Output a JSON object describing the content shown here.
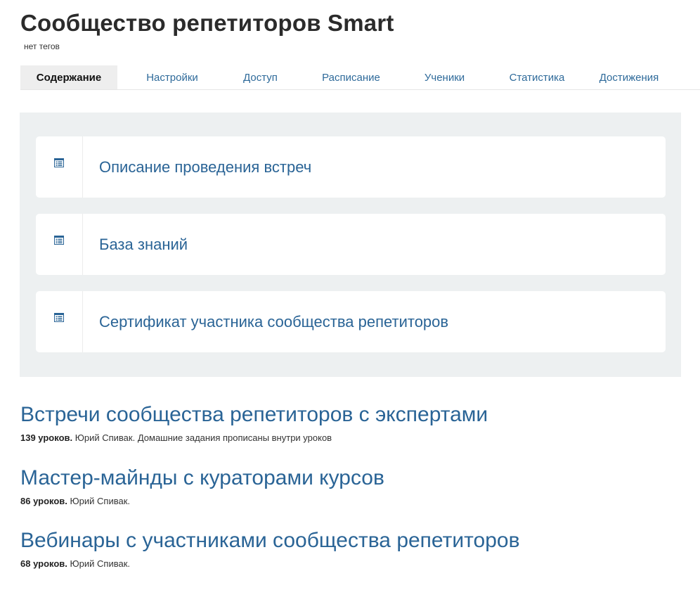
{
  "header": {
    "title": "Сообщество репетиторов Smart",
    "tags": "нет тегов"
  },
  "tabs": [
    {
      "label": "Содержание",
      "active": true
    },
    {
      "label": "Настройки"
    },
    {
      "label": "Доступ"
    },
    {
      "label": "Расписание"
    },
    {
      "label": "Ученики"
    },
    {
      "label": "Статистика"
    },
    {
      "label": "Достижения"
    }
  ],
  "cards": [
    {
      "label": "Описание проведения встреч",
      "icon": "document-list-icon"
    },
    {
      "label": "База знаний",
      "icon": "document-list-icon"
    },
    {
      "label": "Сертификат участника сообщества репетиторов",
      "icon": "document-list-icon"
    }
  ],
  "sections": [
    {
      "title": "Встречи сообщества репетиторов с экспертами",
      "count": "139 уроков.",
      "details": " Юрий Спивак. Домашние задания прописаны внутри уроков"
    },
    {
      "title": "Мастер-майнды с кураторами курсов",
      "count": "86 уроков.",
      "details": " Юрий Спивак."
    },
    {
      "title": "Вебинары с участниками сообщества репетиторов",
      "count": "68 уроков.",
      "details": " Юрий Спивак."
    }
  ],
  "colors": {
    "link": "#2a6496",
    "tab_link": "#2e6a9a",
    "panel_bg": "#edf0f1",
    "active_tab_bg": "#eeeeee"
  }
}
